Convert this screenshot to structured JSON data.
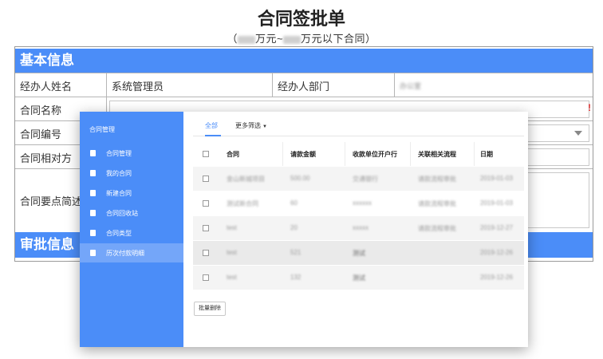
{
  "form": {
    "title": "合同签批单",
    "subtitle_open": "（",
    "subtitle_mid1": "万元~",
    "subtitle_mid2": "万元以下合同）",
    "sections": {
      "basic": "基本信息",
      "approval": "审批信息"
    },
    "labels": {
      "handler_name": "经办人姓名",
      "handler_name_value": "系统管理员",
      "handler_dept": "经办人部门",
      "handler_dept_value": "办公室",
      "contract_name": "合同名称",
      "contract_no": "合同编号",
      "counterparty": "合同相对方",
      "summary": "合同要点简述"
    },
    "required_mark": "!"
  },
  "sidebar": {
    "title": "合同管理",
    "items": [
      {
        "label": "合同管理",
        "icon": "document-icon"
      },
      {
        "label": "我的合同",
        "icon": "document-icon"
      },
      {
        "label": "新建合同",
        "icon": "document-icon"
      },
      {
        "label": "合同回收站",
        "icon": "recycle-icon"
      },
      {
        "label": "合同类型",
        "icon": "document-icon"
      },
      {
        "label": "历次付款明细",
        "icon": "history-icon",
        "active": true
      }
    ]
  },
  "tabs": {
    "all": "全部",
    "more_filter": "更多筛选"
  },
  "table": {
    "headers": [
      "合同",
      "请款金额",
      "收款单位开户行",
      "关联相关流程",
      "日期"
    ],
    "rows": [
      {
        "contract": "金山新城项目",
        "amount": "500.00",
        "bank": "交通银行",
        "flow": "请款流程审批",
        "date": "2019-01-03"
      },
      {
        "contract": "测试新合同",
        "amount": "60",
        "bank": "xxxxxx",
        "flow": "请款流程审批",
        "date": "2019-01-03"
      },
      {
        "contract": "test",
        "amount": "20",
        "bank": "xxxxx",
        "flow": "请款流程审批",
        "date": "2019-12-27"
      },
      {
        "contract": "test",
        "amount": "521",
        "bank": "测试",
        "flow": "",
        "date": "2019-12-26"
      },
      {
        "contract": "test",
        "amount": "132",
        "bank": "测试",
        "flow": "",
        "date": "2019-12-26"
      }
    ]
  },
  "bulk_delete": "批量删除"
}
